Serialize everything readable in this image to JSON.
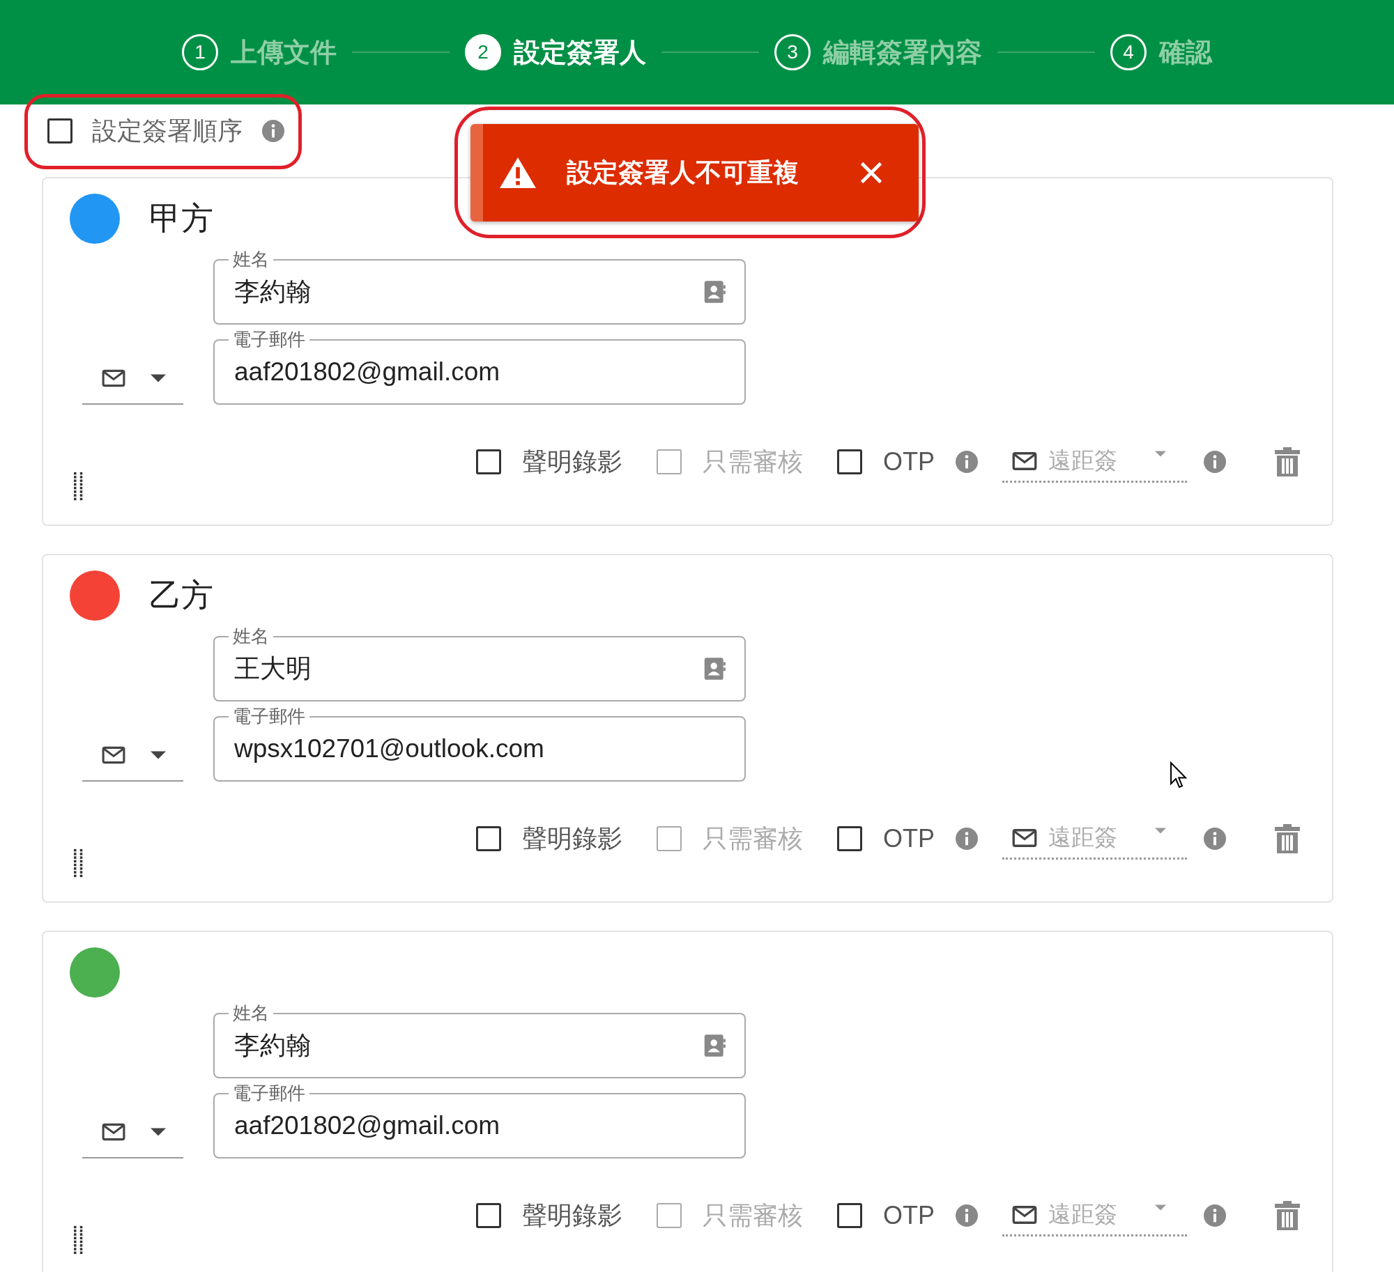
{
  "steps": [
    {
      "number": "1",
      "label": "上傳文件",
      "selected": false
    },
    {
      "number": "2",
      "label": "設定簽署人",
      "selected": true
    },
    {
      "number": "3",
      "label": "編輯簽署內容",
      "selected": false
    },
    {
      "number": "4",
      "label": "確認",
      "selected": false
    }
  ],
  "order_option": {
    "label": "設定簽署順序",
    "checked": false
  },
  "toast": {
    "message": "設定簽署人不可重複"
  },
  "signers": [
    {
      "name": "甲方",
      "color": "#2196f3",
      "name_field": {
        "label": "姓名",
        "value": "李約翰"
      },
      "email_field": {
        "label": "電子郵件",
        "value": "aaf201802@gmail.com"
      },
      "options": [
        {
          "label": "聲明錄影",
          "checked": false,
          "disabled": false,
          "info": false
        },
        {
          "label": "只需審核",
          "checked": false,
          "disabled": true,
          "info": false
        },
        {
          "label": "OTP",
          "checked": false,
          "disabled": false,
          "info": true
        }
      ],
      "sign_method": {
        "value": "遠距簽",
        "disabled": true
      }
    },
    {
      "name": "乙方",
      "color": "#f44336",
      "name_field": {
        "label": "姓名",
        "value": "王大明"
      },
      "email_field": {
        "label": "電子郵件",
        "value": "wpsx102701@outlook.com"
      },
      "options": [
        {
          "label": "聲明錄影",
          "checked": false,
          "disabled": false,
          "info": false
        },
        {
          "label": "只需審核",
          "checked": false,
          "disabled": true,
          "info": false
        },
        {
          "label": "OTP",
          "checked": false,
          "disabled": false,
          "info": true
        }
      ],
      "sign_method": {
        "value": "遠距簽",
        "disabled": true
      }
    },
    {
      "color": "#4caf50",
      "name_field": {
        "label": "姓名",
        "value": "李約翰"
      },
      "email_field": {
        "label": "電子郵件",
        "value": "aaf201802@gmail.com"
      },
      "options": [
        {
          "label": "聲明錄影",
          "checked": false,
          "disabled": false,
          "info": false
        },
        {
          "label": "只需審核",
          "checked": false,
          "disabled": true,
          "info": false
        },
        {
          "label": "OTP",
          "checked": false,
          "disabled": false,
          "info": true
        }
      ],
      "sign_method": {
        "value": "遠距簽",
        "disabled": true
      }
    }
  ]
}
